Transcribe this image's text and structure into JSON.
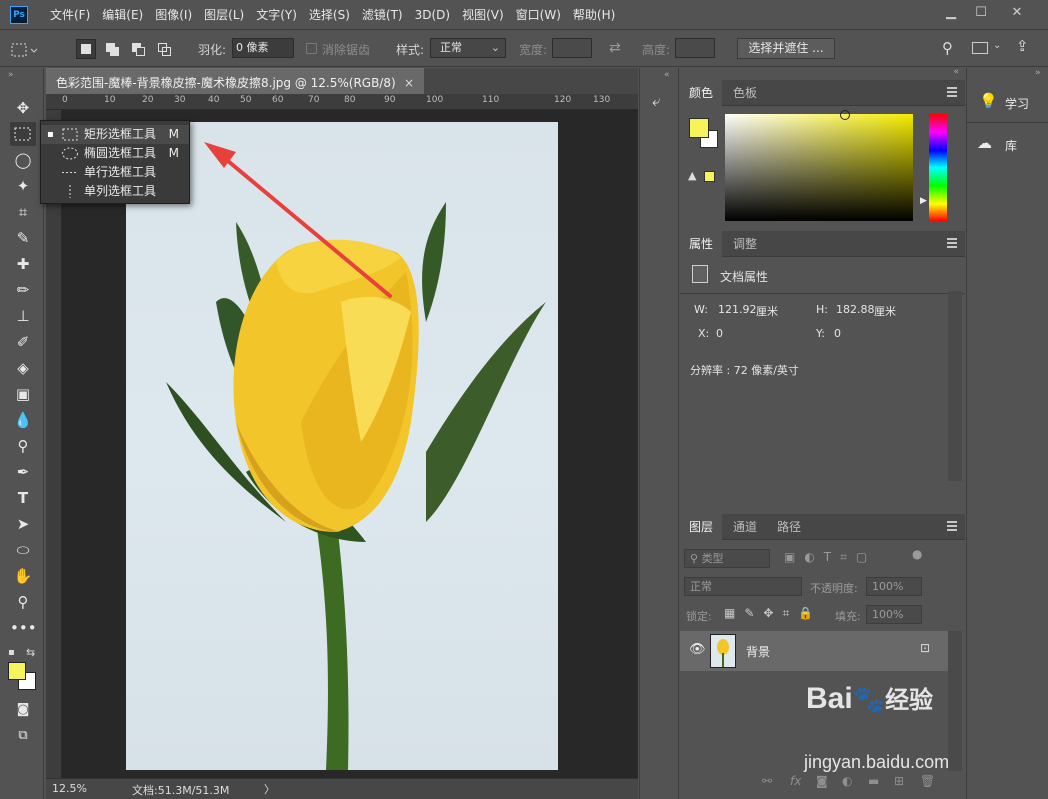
{
  "app": {
    "logo": "Ps",
    "menu": [
      "文件(F)",
      "编辑(E)",
      "图像(I)",
      "图层(L)",
      "文字(Y)",
      "选择(S)",
      "滤镜(T)",
      "3D(D)",
      "视图(V)",
      "窗口(W)",
      "帮助(H)"
    ],
    "window_controls": [
      "minimize-icon",
      "maximize-icon",
      "close-icon"
    ]
  },
  "options": {
    "feather_label": "羽化:",
    "feather_value": "0 像素",
    "antialias_label": "消除锯齿",
    "style_label": "样式:",
    "style_value": "正常",
    "width_label": "宽度:",
    "height_label": "高度:",
    "select_mask_button": "选择并遮住 ..."
  },
  "document": {
    "tab_title": "色彩范围-魔棒-背景橡皮擦-魔术橡皮擦8.jpg @ 12.5%(RGB/8)",
    "close": "×",
    "ruler_numbers": [
      "0",
      "10",
      "20",
      "30",
      "40",
      "50",
      "60",
      "70",
      "80",
      "90",
      "100",
      "110",
      "120",
      "130"
    ],
    "zoom": "12.5%",
    "doc_info": "文档:51.3M/51.3M",
    "status_arrow": "〉"
  },
  "flyout": {
    "items": [
      {
        "label": "矩形选框工具",
        "key": "M",
        "selected": true
      },
      {
        "label": "椭圆选框工具",
        "key": "M",
        "selected": false
      },
      {
        "label": "单行选框工具",
        "key": "",
        "selected": false
      },
      {
        "label": "单列选框工具",
        "key": "",
        "selected": false
      }
    ]
  },
  "color_panel": {
    "tabs": [
      "颜色",
      "色板"
    ],
    "foreground": "#f7f35a",
    "background": "#ffffff",
    "hue_color": "#f5eb00"
  },
  "properties_panel": {
    "tabs": [
      "属性",
      "调整"
    ],
    "title": "文档属性",
    "w_label": "W:",
    "w_value": "121.92",
    "w_unit": "厘米",
    "h_label": "H:",
    "h_value": "182.88",
    "h_unit": "厘米",
    "x_label": "X:",
    "x_value": "0",
    "y_label": "Y:",
    "y_value": "0",
    "resolution": "分辨率 : 72 像素/英寸"
  },
  "layers_panel": {
    "tabs": [
      "图层",
      "通道",
      "路径"
    ],
    "filter_label": "类型",
    "blend_mode": "正常",
    "opacity_label": "不透明度:",
    "opacity_value": "100%",
    "lock_label": "锁定:",
    "fill_label": "填充:",
    "fill_value": "100%",
    "layer_name": "背景",
    "fx": "fx"
  },
  "right_dock": {
    "items": [
      "学习",
      "库"
    ]
  },
  "watermark": {
    "brand": "Bai",
    "brand2": "经验",
    "url": "jingyan.baidu.com"
  },
  "colors": {
    "accent_arrow": "#e8413c",
    "ui_bg": "#535353"
  }
}
